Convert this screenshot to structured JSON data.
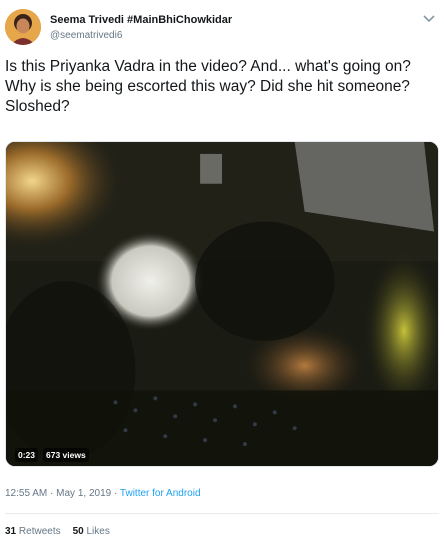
{
  "author": {
    "name": "Seema Trivedi #MainBhiChowkidar",
    "handle": "@seematrivedi6"
  },
  "tweet": {
    "text": "Is this Priyanka Vadra in the video? And... what's going on? Why is she being escorted this way? Did she hit someone? Sloshed?"
  },
  "video": {
    "duration": "0:23",
    "views": "673 views"
  },
  "meta": {
    "time": "12:55 AM",
    "separator": " · ",
    "date": "May 1, 2019",
    "source": "Twitter for Android"
  },
  "stats": {
    "retweets_count": "31",
    "retweets_label": "Retweets",
    "likes_count": "50",
    "likes_label": "Likes"
  },
  "icons": {
    "menu": "chevron-down-icon",
    "avatar": "profile-photo"
  },
  "colors": {
    "link": "#1da1f2",
    "secondary_text": "#657786",
    "primary_text": "#14171a"
  }
}
